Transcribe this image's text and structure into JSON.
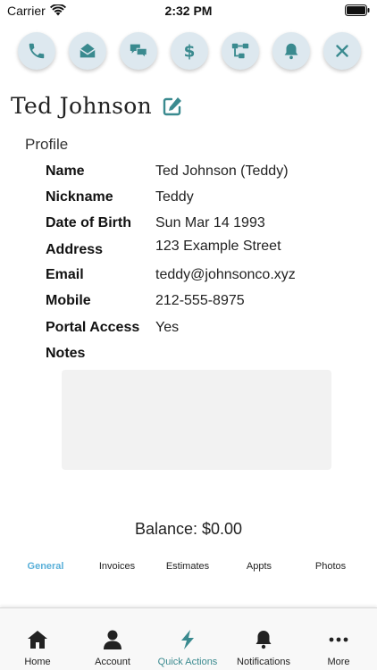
{
  "status_bar": {
    "carrier": "Carrier",
    "time": "2:32 PM"
  },
  "action_buttons": [
    {
      "name": "call",
      "icon": "phone-icon"
    },
    {
      "name": "email",
      "icon": "envelope-open-icon"
    },
    {
      "name": "chat",
      "icon": "chat-bubbles-icon"
    },
    {
      "name": "payment",
      "icon": "dollar-icon"
    },
    {
      "name": "workflow",
      "icon": "sitemap-icon"
    },
    {
      "name": "alert",
      "icon": "bell-icon"
    },
    {
      "name": "close",
      "icon": "close-icon"
    }
  ],
  "contact": {
    "name": "Ted Johnson"
  },
  "profile": {
    "section_label": "Profile",
    "fields": [
      {
        "key": "Name",
        "value": "Ted Johnson (Teddy)"
      },
      {
        "key": "Nickname",
        "value": "Teddy"
      },
      {
        "key": "Date of Birth",
        "value": "Sun Mar 14 1993"
      },
      {
        "key": "Address",
        "value": "123 Example Street"
      },
      {
        "key": "Email",
        "value": "teddy@johnsonco.xyz"
      },
      {
        "key": "Mobile",
        "value": "212-555-8975"
      },
      {
        "key": "Portal Access",
        "value": "Yes"
      },
      {
        "key": "Notes",
        "value": ""
      }
    ]
  },
  "balance": "Balance: $0.00",
  "tabs": [
    {
      "label": "General",
      "active": true
    },
    {
      "label": "Invoices",
      "active": false
    },
    {
      "label": "Estimates",
      "active": false
    },
    {
      "label": "Appts",
      "active": false
    },
    {
      "label": "Photos",
      "active": false
    }
  ],
  "bottom_nav": [
    {
      "label": "Home",
      "icon": "home-icon",
      "active": false
    },
    {
      "label": "Account",
      "icon": "user-icon",
      "active": false
    },
    {
      "label": "Quick Actions",
      "icon": "lightning-icon",
      "active": true
    },
    {
      "label": "Notifications",
      "icon": "bell-icon",
      "active": false
    },
    {
      "label": "More",
      "icon": "more-dots-icon",
      "active": false
    }
  ],
  "colors": {
    "accent": "#3a8a8f",
    "tab_active": "#5ab0d9",
    "action_button_bg": "#dde8ef"
  }
}
